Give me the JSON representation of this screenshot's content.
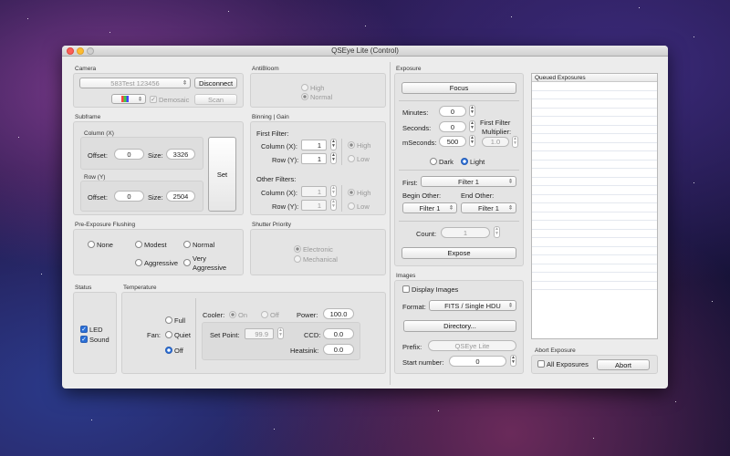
{
  "window": {
    "title": "QSEye Lite (Control)"
  },
  "camera": {
    "section": "Camera",
    "device": "583Test 123456",
    "disconnect": "Disconnect",
    "demosaic": "Demosaic",
    "scan": "Scan"
  },
  "antibloom": {
    "section": "AntiBloom",
    "high": "High",
    "normal": "Normal"
  },
  "subframe": {
    "section": "Subframe",
    "column_title": "Column (X)",
    "row_title": "Row (Y)",
    "offset": "Offset:",
    "size": "Size:",
    "col_offset": "0",
    "col_size": "3326",
    "row_offset": "0",
    "row_size": "2504",
    "set": "Set"
  },
  "binning": {
    "section": "Binning | Gain",
    "first_filter": "First Filter:",
    "other_filters": "Other Filters:",
    "column": "Column (X):",
    "row": "Row (Y):",
    "ff_col": "1",
    "ff_row": "1",
    "of_col": "1",
    "of_row": "1",
    "high": "High",
    "low": "Low"
  },
  "flushing": {
    "section": "Pre-Exposure Flushing",
    "none": "None",
    "modest": "Modest",
    "normal": "Normal",
    "aggressive": "Aggressive",
    "very1": "Very",
    "very2": "Aggressive"
  },
  "shutter": {
    "section": "Shutter Priority",
    "electronic": "Electronic",
    "mechanical": "Mechanical"
  },
  "status": {
    "section": "Status",
    "led": "LED",
    "sound": "Sound"
  },
  "temperature": {
    "section": "Temperature",
    "fan": "Fan:",
    "full": "Full",
    "quiet": "Quiet",
    "off": "Off",
    "cooler": "Cooler:",
    "on": "On",
    "cooler_off": "Off",
    "power": "Power:",
    "power_val": "100.0",
    "setpoint": "Set Point:",
    "setpoint_val": "99.9",
    "ccd": "CCD:",
    "ccd_val": "0.0",
    "heatsink": "Heatsink:",
    "heatsink_val": "0.0"
  },
  "exposure": {
    "section": "Exposure",
    "focus": "Focus",
    "minutes": "Minutes:",
    "minutes_val": "0",
    "seconds": "Seconds:",
    "seconds_val": "0",
    "mseconds": "mSeconds:",
    "mseconds_val": "500",
    "multiplier1": "First Filter",
    "multiplier2": "Multiplier:",
    "multiplier_val": "1.0",
    "dark": "Dark",
    "light": "Light",
    "first": "First:",
    "first_val": "Filter 1",
    "begin_other": "Begin Other:",
    "end_other": "End Other:",
    "begin_val": "Filter 1",
    "end_val": "Filter 1",
    "count": "Count:",
    "count_val": "1",
    "expose": "Expose"
  },
  "images": {
    "section": "Images",
    "display": "Display Images",
    "format": "Format:",
    "format_val": "FITS / Single HDU",
    "directory": "Directory...",
    "prefix": "Prefix:",
    "prefix_val": "QSEye Lite",
    "start": "Start number:",
    "start_val": "0"
  },
  "queue": {
    "section": "Queued Exposures",
    "rows": 24
  },
  "abort": {
    "section": "Abort Exposure",
    "all": "All Exposures",
    "abort": "Abort"
  }
}
